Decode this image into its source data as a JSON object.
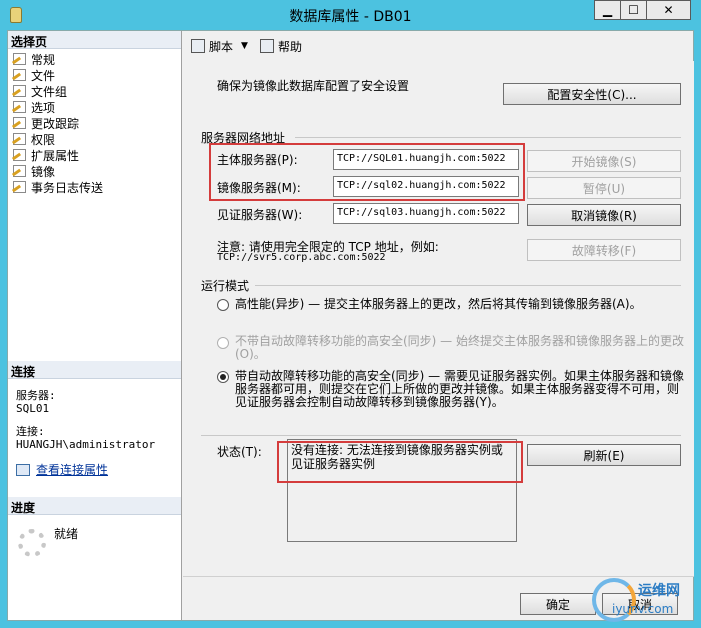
{
  "window": {
    "title": "数据库属性 - DB01",
    "min_glyph": "▁",
    "max_glyph": "☐",
    "close_glyph": "✕"
  },
  "left": {
    "select_page_header": "选择页",
    "nav": [
      "常规",
      "文件",
      "文件组",
      "选项",
      "更改跟踪",
      "权限",
      "扩展属性",
      "镜像",
      "事务日志传送"
    ],
    "connection_header": "连接",
    "server_label": "服务器:",
    "server_value": "SQL01",
    "conn_label": "连接:",
    "conn_value": "HUANGJH\\administrator",
    "view_conn_link": "查看连接属性",
    "progress_header": "进度",
    "progress_status": "就绪"
  },
  "toolbar": {
    "script": "脚本",
    "help": "帮助"
  },
  "mirroring": {
    "intro": "确保为镜像此数据库配置了安全设置",
    "configure_security": "配置安全性(C)...",
    "network_group": "服务器网络地址",
    "principal_label": "主体服务器(P):",
    "principal_value": "TCP://SQL01.huangjh.com:5022",
    "mirror_label": "镜像服务器(M):",
    "mirror_value": "TCP://sql02.huangjh.com:5022",
    "witness_label": "见证服务器(W):",
    "witness_value": "TCP://sql03.huangjh.com:5022",
    "start_mirroring": "开始镜像(S)",
    "pause": "暂停(U)",
    "remove_mirroring": "取消镜像(R)",
    "failover": "故障转移(F)",
    "note_line1": "注意: 请使用完全限定的 TCP 地址，例如:",
    "note_line2": "TCP://svr5.corp.abc.com:5022",
    "mode_group": "运行模式",
    "mode_high_perf": "高性能(异步) — 提交主体服务器上的更改，然后将其传输到镜像服务器(A)。",
    "mode_high_safety_no_failover": "不带自动故障转移功能的高安全(同步) — 始终提交主体服务器和镜像服务器上的更改(O)。",
    "mode_high_safety_auto": "带自动故障转移功能的高安全(同步) — 需要见证服务器实例。如果主体服务器和镜像服务器都可用，则提交在它们上所做的更改并镜像。如果主体服务器变得不可用，则见证服务器会控制自动故障转移到镜像服务器(Y)。",
    "status_label": "状态(T):",
    "status_text": "没有连接: 无法连接到镜像服务器实例或见证服务器实例",
    "refresh": "刷新(E)"
  },
  "footer": {
    "ok": "确定",
    "cancel": "取消"
  },
  "watermark": {
    "cn": "运维网",
    "en": "iyunv.com"
  },
  "colors": {
    "highlight_box": "#d43c3c",
    "titlebar": "#4cc2e0"
  }
}
